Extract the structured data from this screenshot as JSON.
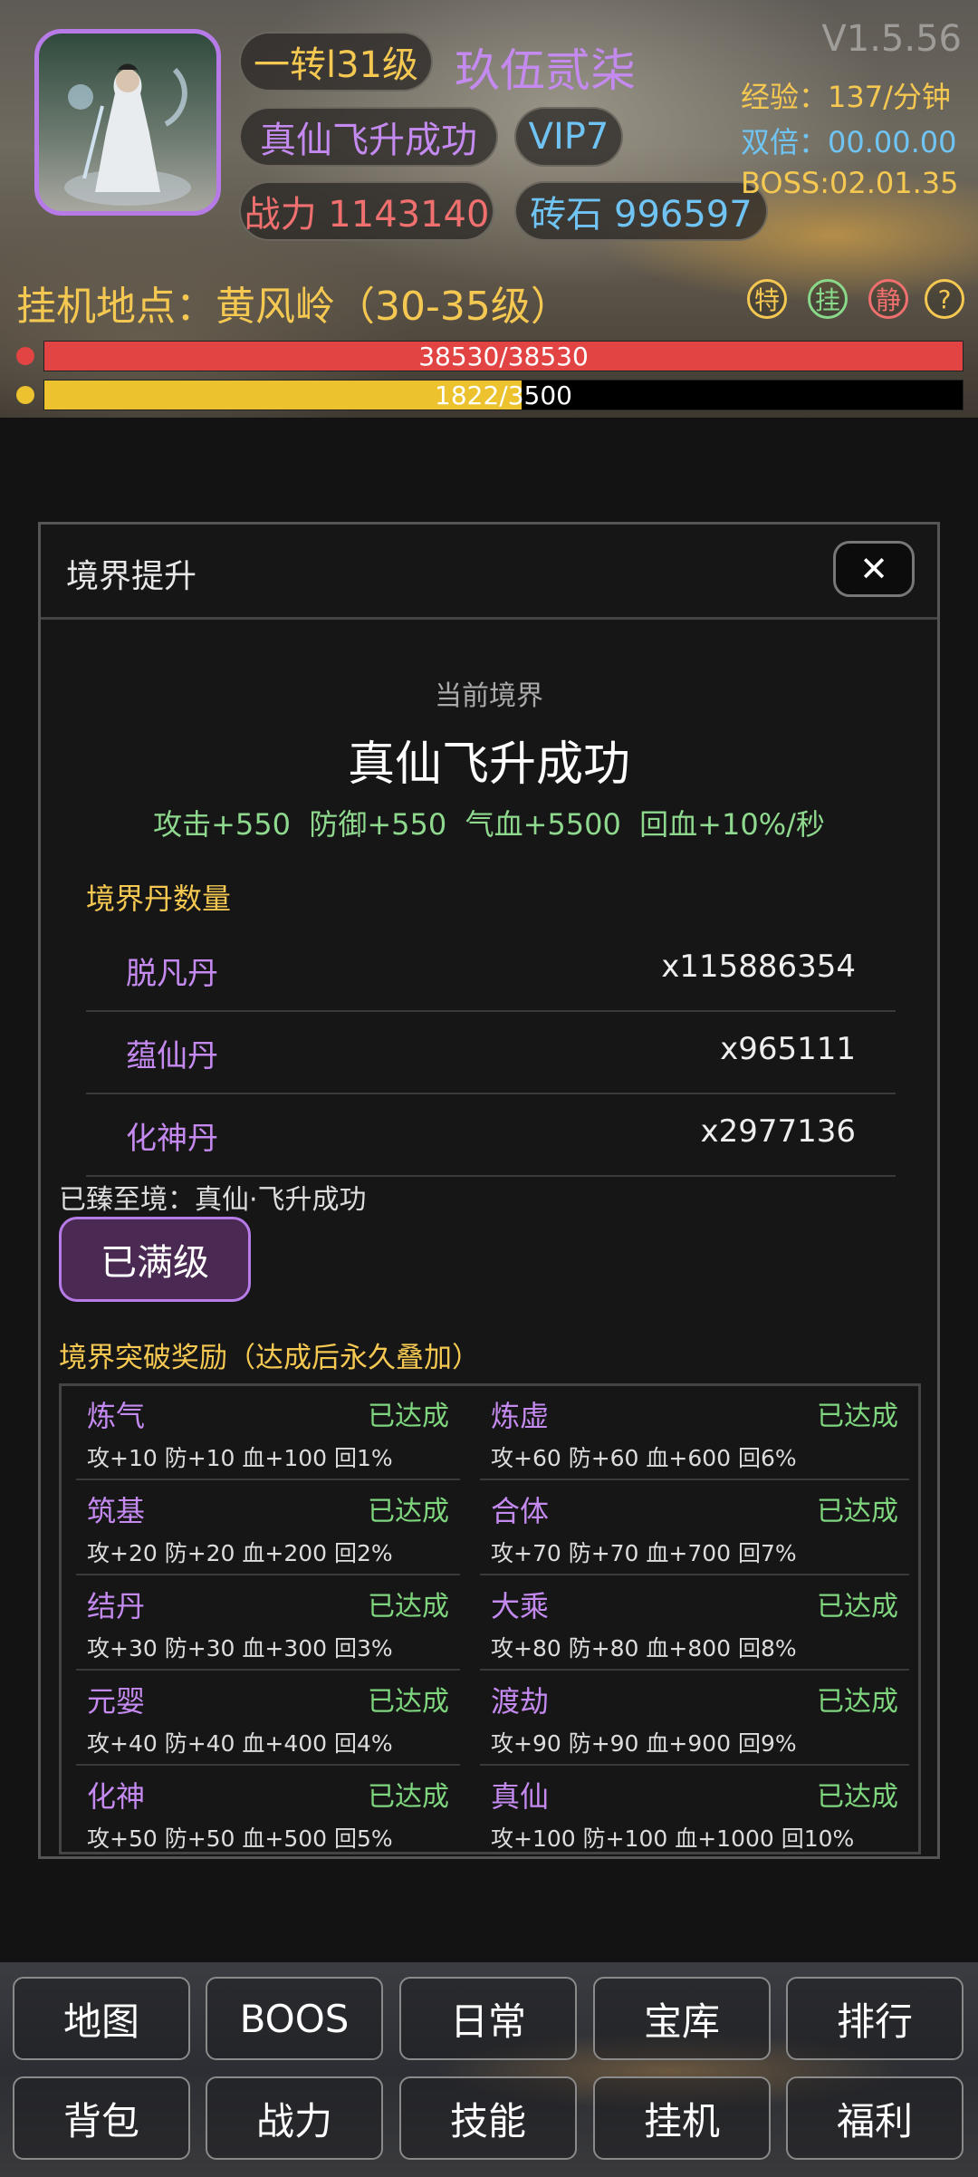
{
  "header": {
    "rank_label": "一转l31级",
    "character_name": "玖伍贰柒",
    "realm_status": "真仙飞升成功",
    "vip": "VIP7",
    "power_label": "战力 1143140",
    "gems_label": "砖石 996597",
    "version": "V1.5.56",
    "exp_rate": "经验：137/分钟",
    "double_time": "双倍：00.00.00",
    "boss_time": "BOSS:02.01.35",
    "location": "挂机地点：黄风岭（30-35级）",
    "quick_icons": [
      "特",
      "挂",
      "静",
      "?"
    ],
    "hp_text": "38530/38530",
    "hp_fraction": 1.0,
    "exp_text": "1822/3500",
    "exp_fraction": 0.52,
    "colors": {
      "hp": "#e24444",
      "exp": "#ecc22e",
      "accent_purple": "#b77be8"
    }
  },
  "modal": {
    "title": "境界提升",
    "close_label": "✕",
    "current_label": "当前境界",
    "current_realm": "真仙飞升成功",
    "bonus_line": "攻击+550  防御+550  气血+5500  回血+10%/秒",
    "pills_header": "境界丹数量",
    "pills": [
      {
        "name": "脱凡丹",
        "count": "x115886354"
      },
      {
        "name": "蕴仙丹",
        "count": "x965111"
      },
      {
        "name": "化神丹",
        "count": "x2977136"
      }
    ],
    "reached_text": "已臻至境：真仙·飞升成功",
    "max_button": "已满级",
    "rewards_header": "境界突破奖励（达成后永久叠加）",
    "rewards": [
      {
        "name": "炼气",
        "status": "已达成",
        "desc": "攻+10 防+10 血+100 回1%"
      },
      {
        "name": "炼虚",
        "status": "已达成",
        "desc": "攻+60 防+60 血+600 回6%"
      },
      {
        "name": "筑基",
        "status": "已达成",
        "desc": "攻+20 防+20 血+200 回2%"
      },
      {
        "name": "合体",
        "status": "已达成",
        "desc": "攻+70 防+70 血+700 回7%"
      },
      {
        "name": "结丹",
        "status": "已达成",
        "desc": "攻+30 防+30 血+300 回3%"
      },
      {
        "name": "大乘",
        "status": "已达成",
        "desc": "攻+80 防+80 血+800 回8%"
      },
      {
        "name": "元婴",
        "status": "已达成",
        "desc": "攻+40 防+40 血+400 回4%"
      },
      {
        "name": "渡劫",
        "status": "已达成",
        "desc": "攻+90 防+90 血+900 回9%"
      },
      {
        "name": "化神",
        "status": "已达成",
        "desc": "攻+50 防+50 血+500 回5%"
      },
      {
        "name": "真仙",
        "status": "已达成",
        "desc": "攻+100 防+100 血+1000 回10%"
      }
    ]
  },
  "nav": {
    "row1": [
      "地图",
      "BOOS",
      "日常",
      "宝库",
      "排行"
    ],
    "row2": [
      "背包",
      "战力",
      "技能",
      "挂机",
      "福利"
    ]
  }
}
